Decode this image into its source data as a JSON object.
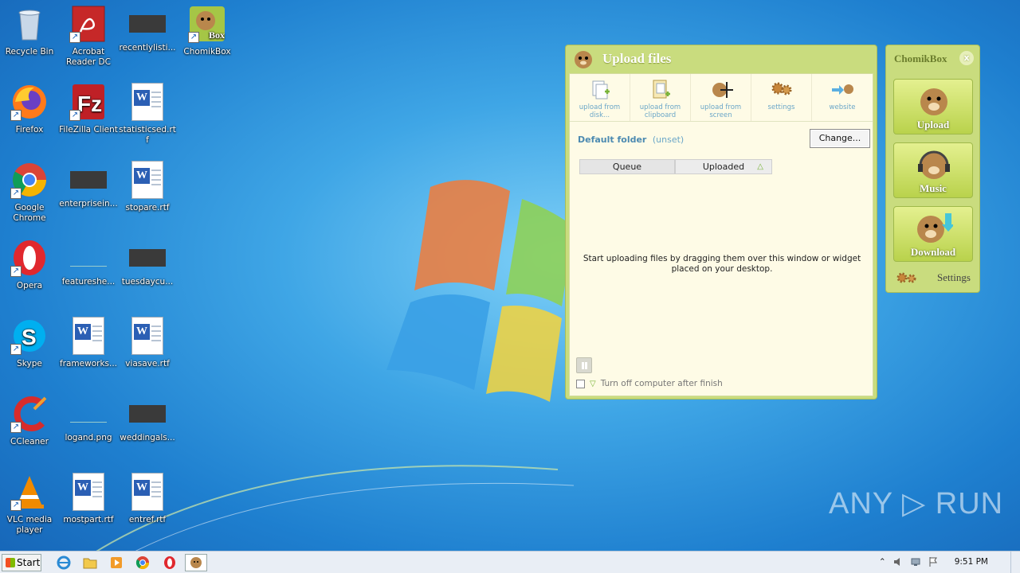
{
  "desktop": {
    "icons": [
      {
        "name": "recycle-bin-icon",
        "label": "Recycle Bin"
      },
      {
        "name": "acrobat-reader-icon",
        "label": "Acrobat Reader DC"
      },
      {
        "name": "file-thumbnail-icon",
        "label": "recentlylisti..."
      },
      {
        "name": "chomikbox-icon",
        "label": "ChomikBox"
      },
      {
        "name": "firefox-icon",
        "label": "Firefox"
      },
      {
        "name": "filezilla-icon",
        "label": "FileZilla Client"
      },
      {
        "name": "word-document-icon",
        "label": "statisticsed.rtf"
      },
      {
        "name": "chrome-icon",
        "label": "Google Chrome"
      },
      {
        "name": "file-thumbnail-icon",
        "label": "enterprisein..."
      },
      {
        "name": "word-document-icon",
        "label": "stopare.rtf"
      },
      {
        "name": "opera-icon",
        "label": "Opera"
      },
      {
        "name": "file-thumbnail-icon",
        "label": "featureshe..."
      },
      {
        "name": "file-thumbnail-icon",
        "label": "tuesdaycu..."
      },
      {
        "name": "skype-icon",
        "label": "Skype"
      },
      {
        "name": "word-document-icon",
        "label": "frameworks..."
      },
      {
        "name": "word-document-icon",
        "label": "viasave.rtf"
      },
      {
        "name": "ccleaner-icon",
        "label": "CCleaner"
      },
      {
        "name": "file-thumbnail-icon",
        "label": "logand.png"
      },
      {
        "name": "file-thumbnail-icon",
        "label": "weddingals..."
      },
      {
        "name": "vlc-icon",
        "label": "VLC media player"
      },
      {
        "name": "word-document-icon",
        "label": "mostpart.rtf"
      },
      {
        "name": "word-document-icon",
        "label": "entref.rtf"
      }
    ]
  },
  "upload_window": {
    "title": "Upload files",
    "toolbar": [
      {
        "label": "upload from disk...",
        "icon": "upload-disk-icon"
      },
      {
        "label": "upload from clipboard",
        "icon": "clipboard-icon"
      },
      {
        "label": "upload from screen",
        "icon": "screen-capture-icon"
      },
      {
        "label": "settings",
        "icon": "gears-icon"
      },
      {
        "label": "website",
        "icon": "website-icon"
      }
    ],
    "default_folder_label": "Default folder",
    "default_folder_value": "(unset)",
    "change_button": "Change...",
    "tabs": {
      "queue": "Queue",
      "uploaded": "Uploaded",
      "uploaded_arrow": "△"
    },
    "empty_message": "Start uploading files by dragging them over this window or widget placed on your desktop.",
    "shutdown_label": "Turn off computer after finish"
  },
  "widget": {
    "title": "ChomikBox",
    "close": "x",
    "buttons": {
      "upload": "Upload",
      "music": "Music",
      "download": "Download"
    },
    "settings": "Settings"
  },
  "watermark": "ANY ▷ RUN",
  "taskbar": {
    "start": "Start",
    "clock": "9:51 PM"
  },
  "colors": {
    "panel_green": "#c9dc7e",
    "panel_body": "#fefbe6",
    "link_blue": "#4c8ab1"
  }
}
